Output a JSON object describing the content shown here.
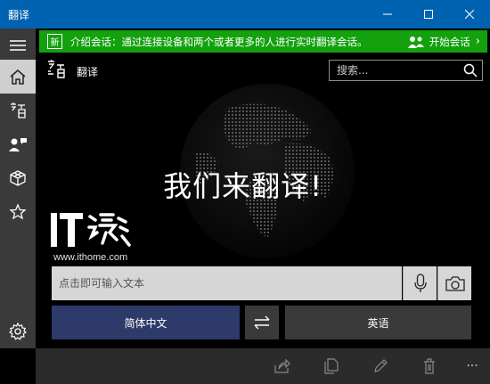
{
  "window": {
    "title": "翻译"
  },
  "banner": {
    "badge": "新",
    "text": "介绍会话：通过连接设备和两个或者更多的人进行实时翻译会话。",
    "start_label": "开始会话",
    "chevron": "›"
  },
  "header": {
    "app_name": "翻译",
    "search_placeholder": "搜索..."
  },
  "hero": {
    "text": "我们来翻译!"
  },
  "watermark": {
    "url": "www.ithome.com"
  },
  "input": {
    "placeholder": "点击即可输入文本"
  },
  "languages": {
    "from": "简体中文",
    "to": "英语"
  },
  "bottom": {
    "more": "···"
  },
  "colors": {
    "titlebar": "#0063b1",
    "banner": "#13a10e",
    "from_lang": "#2d3a6a",
    "rail": "#3a3a3a"
  }
}
